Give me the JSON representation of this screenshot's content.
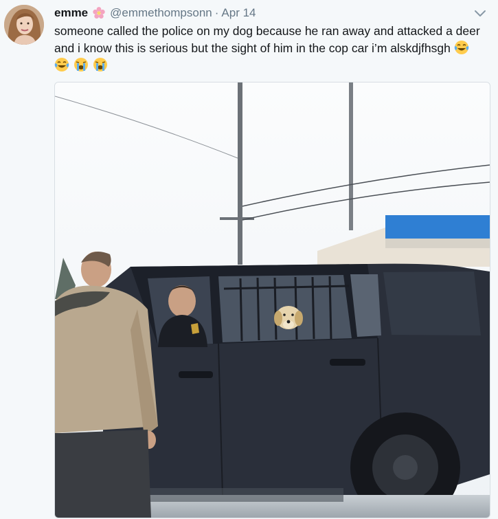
{
  "tweet": {
    "author_name": "emme",
    "handle": "@emmethompsonn",
    "separator": "·",
    "timestamp": "Apr 14",
    "text": "someone called the police on my dog because he ran away and attacked a deer and i know this is serious but the sight of him in the cop car i’m alskdjfhsgh",
    "trailing_emojis": [
      "face-with-tears-of-joy",
      "face-with-tears-of-joy",
      "loudly-crying-face",
      "loudly-crying-face"
    ],
    "name_emoji": "cherry-blossom",
    "menu_icon": "chevron-down-icon"
  },
  "media": {
    "description_icon": "photo",
    "colors": {
      "sky": "#f7f9fb",
      "suv": "#2a2f3a",
      "awning": "#2f7fd3",
      "jacket": "#b9a88f"
    }
  }
}
